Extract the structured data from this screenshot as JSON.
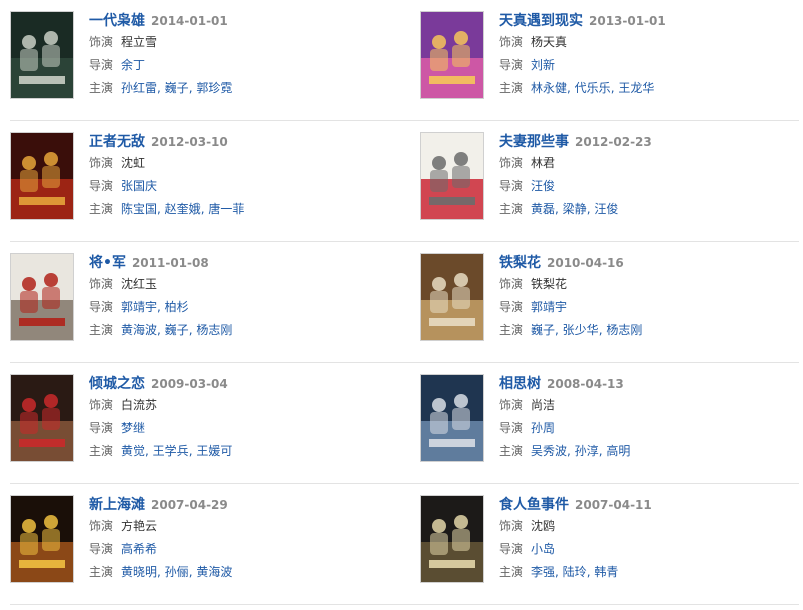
{
  "labels": {
    "role": "饰演",
    "director": "导演",
    "cast": "主演"
  },
  "rows": [
    [
      {
        "title": "一代枭雄",
        "date": "2014-01-01",
        "role": "程立雪",
        "director": "余丁",
        "cast": [
          "孙红雷",
          "巍子",
          "郭珍霓"
        ],
        "poster_colors": [
          "#1a2b24",
          "#2f4a3c",
          "#c9cfc4"
        ]
      },
      {
        "title": "天真遇到现实",
        "date": "2013-01-01",
        "role": "杨天真",
        "director": "刘新",
        "cast": [
          "林永健",
          "代乐乐",
          "王龙华"
        ],
        "poster_colors": [
          "#7a3a9a",
          "#e25fa8",
          "#f6c65a"
        ]
      }
    ],
    [
      {
        "title": "正者无敌",
        "date": "2012-03-10",
        "role": "沈虹",
        "director": "张国庆",
        "cast": [
          "陈宝国",
          "赵奎娥",
          "唐一菲"
        ],
        "poster_colors": [
          "#3a0e0a",
          "#b52a16",
          "#e6a43a"
        ]
      },
      {
        "title": "夫妻那些事",
        "date": "2012-02-23",
        "role": "林君",
        "director": "汪俊",
        "cast": [
          "黄磊",
          "梁静",
          "汪俊"
        ],
        "poster_colors": [
          "#f2f0ea",
          "#c81c2a",
          "#6b6b6b"
        ]
      }
    ],
    [
      {
        "title": "将•军",
        "date": "2011-01-08",
        "role": "沈红玉",
        "director": "郭靖宇, 柏杉",
        "cast": [
          "黄海波",
          "巍子",
          "杨志刚"
        ],
        "poster_colors": [
          "#e9e6df",
          "#7a6f62",
          "#b0221a"
        ]
      },
      {
        "title": "铁梨花",
        "date": "2010-04-16",
        "role": "铁梨花",
        "director": "郭靖宇",
        "cast": [
          "巍子",
          "张少华",
          "杨志刚"
        ],
        "poster_colors": [
          "#6b4a2a",
          "#c9a46a",
          "#e8dcc2"
        ]
      }
    ],
    [
      {
        "title": "倾城之恋",
        "date": "2009-03-04",
        "role": "白流苏",
        "director": "梦继",
        "cast": [
          "黄觉",
          "王学兵",
          "王媛可"
        ],
        "poster_colors": [
          "#2a1a14",
          "#8c5a3c",
          "#c92a2a"
        ]
      },
      {
        "title": "相思树",
        "date": "2008-04-13",
        "role": "尚洁",
        "director": "孙周",
        "cast": [
          "吴秀波",
          "孙淳",
          "高明"
        ],
        "poster_colors": [
          "#1f3550",
          "#6f8fb0",
          "#d8dde4"
        ]
      }
    ],
    [
      {
        "title": "新上海滩",
        "date": "2007-04-29",
        "role": "方艳云",
        "director": "高希希",
        "cast": [
          "黄晓明",
          "孙俪",
          "黄海波"
        ],
        "poster_colors": [
          "#1a0f08",
          "#a8561c",
          "#f0c040"
        ]
      },
      {
        "title": "食人鱼事件",
        "date": "2007-04-11",
        "role": "沈鸥",
        "director": "小岛",
        "cast": [
          "李强",
          "陆玲",
          "韩青"
        ],
        "poster_colors": [
          "#1c1a18",
          "#6a5a3a",
          "#e2d6a8"
        ]
      }
    ]
  ]
}
